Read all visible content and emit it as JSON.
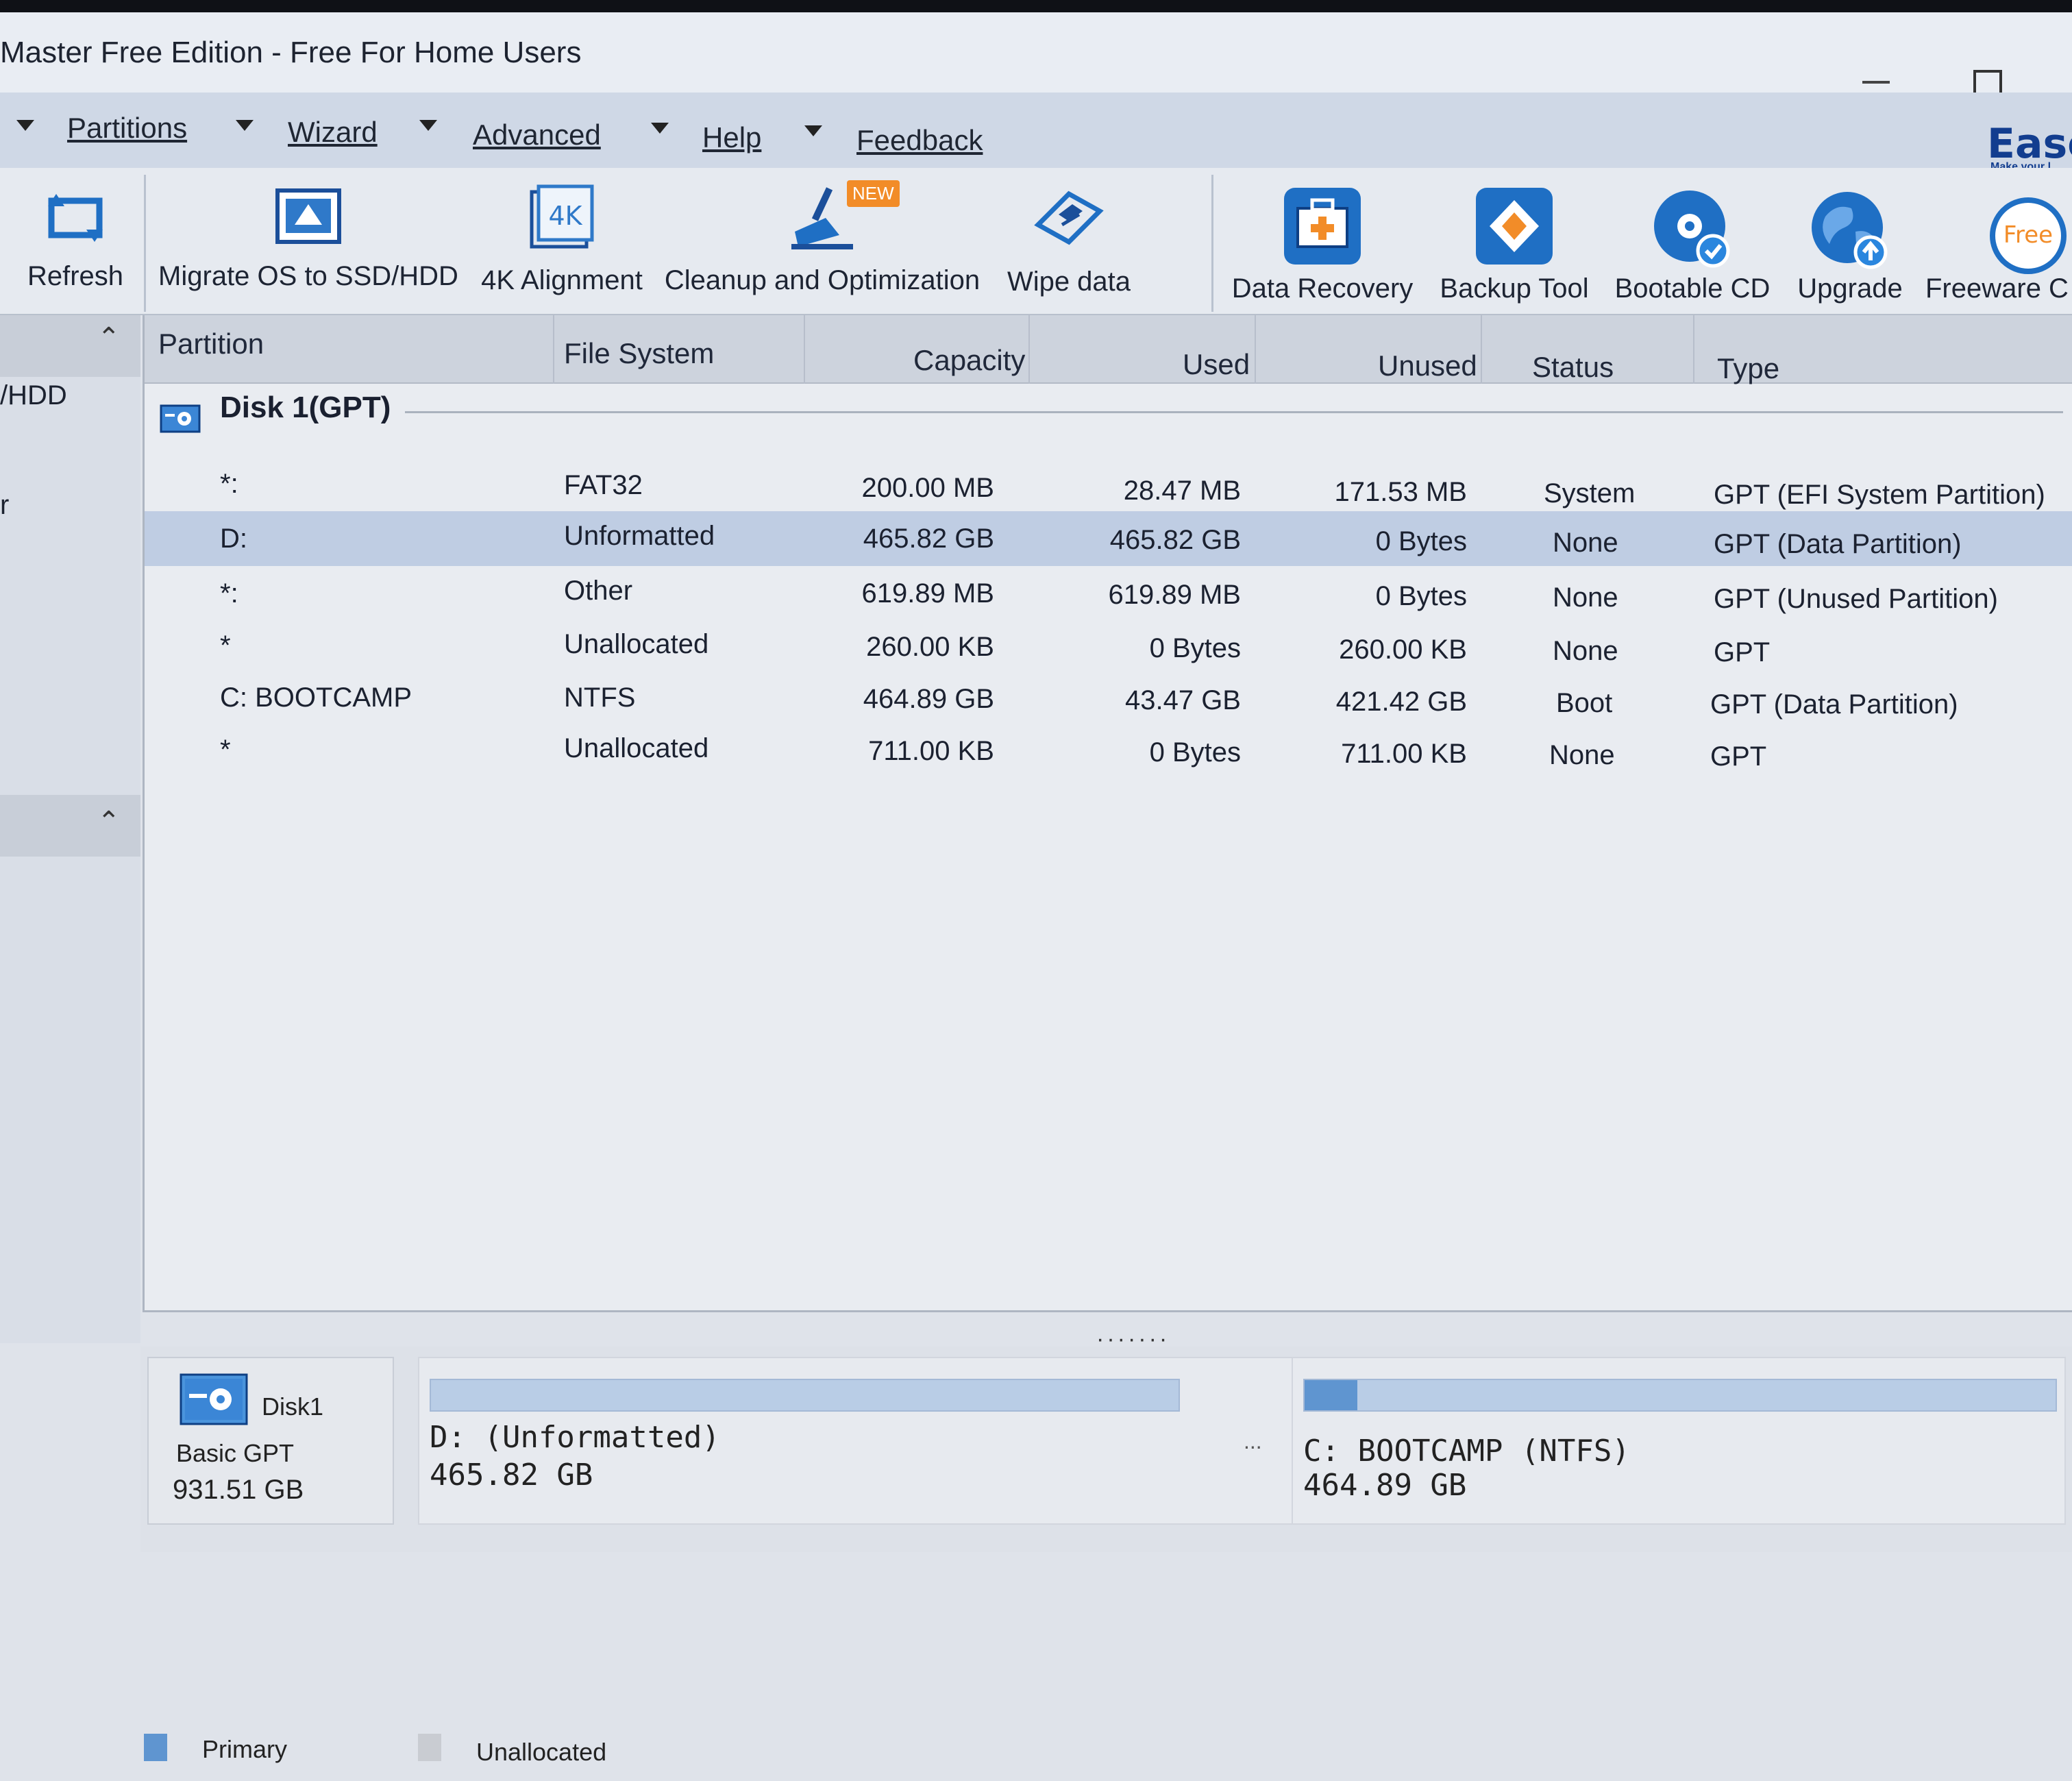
{
  "window": {
    "title": "Master Free Edition - Free For Home Users"
  },
  "menu": {
    "items": [
      {
        "label": "Partitions"
      },
      {
        "label": "Wizard"
      },
      {
        "label": "Advanced"
      },
      {
        "label": "Help"
      },
      {
        "label": "Feedback"
      }
    ],
    "brand": "Ease",
    "brand_sub": "Make your l"
  },
  "toolbar": {
    "refresh": "Refresh",
    "migrate_os": "Migrate OS to SSD/HDD",
    "alignment_4k": "4K Alignment",
    "cleanup": "Cleanup and Optimization",
    "cleanup_badge": "NEW",
    "wipe": "Wipe data",
    "data_recovery": "Data Recovery",
    "backup_tool": "Backup Tool",
    "bootable_cd": "Bootable CD",
    "upgrade": "Upgrade",
    "freeware": "Freeware C",
    "freeware_icon_text": "Free",
    "alignment_icon_text": "4K"
  },
  "left_pane": {
    "text_1": "/HDD",
    "text_2": "r"
  },
  "table": {
    "headers": {
      "partition": "Partition",
      "file_system": "File System",
      "capacity": "Capacity",
      "used": "Used",
      "unused": "Unused",
      "status": "Status",
      "type": "Type"
    },
    "disk_label": "Disk 1(GPT)",
    "rows": [
      {
        "partition": "*:",
        "fs": "FAT32",
        "capacity": "200.00 MB",
        "used": "28.47 MB",
        "unused": "171.53 MB",
        "status": "System",
        "type": "GPT (EFI System Partition)"
      },
      {
        "partition": "D:",
        "fs": "Unformatted",
        "capacity": "465.82 GB",
        "used": "465.82 GB",
        "unused": "0 Bytes",
        "status": "None",
        "type": "GPT (Data Partition)"
      },
      {
        "partition": "*:",
        "fs": "Other",
        "capacity": "619.89 MB",
        "used": "619.89 MB",
        "unused": "0 Bytes",
        "status": "None",
        "type": "GPT (Unused Partition)"
      },
      {
        "partition": "*",
        "fs": "Unallocated",
        "capacity": "260.00 KB",
        "used": "0 Bytes",
        "unused": "260.00 KB",
        "status": "None",
        "type": "GPT"
      },
      {
        "partition": "C: BOOTCAMP",
        "fs": "NTFS",
        "capacity": "464.89 GB",
        "used": "43.47 GB",
        "unused": "421.42 GB",
        "status": "Boot",
        "type": "GPT (Data Partition)"
      },
      {
        "partition": "*",
        "fs": "Unallocated",
        "capacity": "711.00 KB",
        "used": "0 Bytes",
        "unused": "711.00 KB",
        "status": "None",
        "type": "GPT"
      }
    ],
    "selected_row": 1
  },
  "splitter": "·······",
  "disk_map": {
    "disk_name": "Disk1",
    "disk_type": "Basic GPT",
    "disk_size": "931.51 GB",
    "partitions": [
      {
        "name": "D: (Unformatted)",
        "size": "465.82 GB",
        "used_fraction": 0
      },
      {
        "name": "C: BOOTCAMP (NTFS)",
        "size": "464.89 GB",
        "used_fraction": 0.07
      }
    ],
    "separator_dots": "..."
  },
  "legend": {
    "primary": "Primary",
    "unallocated": "Unallocated",
    "primary_color": "#5f95d0",
    "unallocated_color": "#c9ccd2"
  },
  "colors": {
    "accent": "#1565c0",
    "selected_row": "#bfcde3",
    "badge": "#f28c28"
  }
}
